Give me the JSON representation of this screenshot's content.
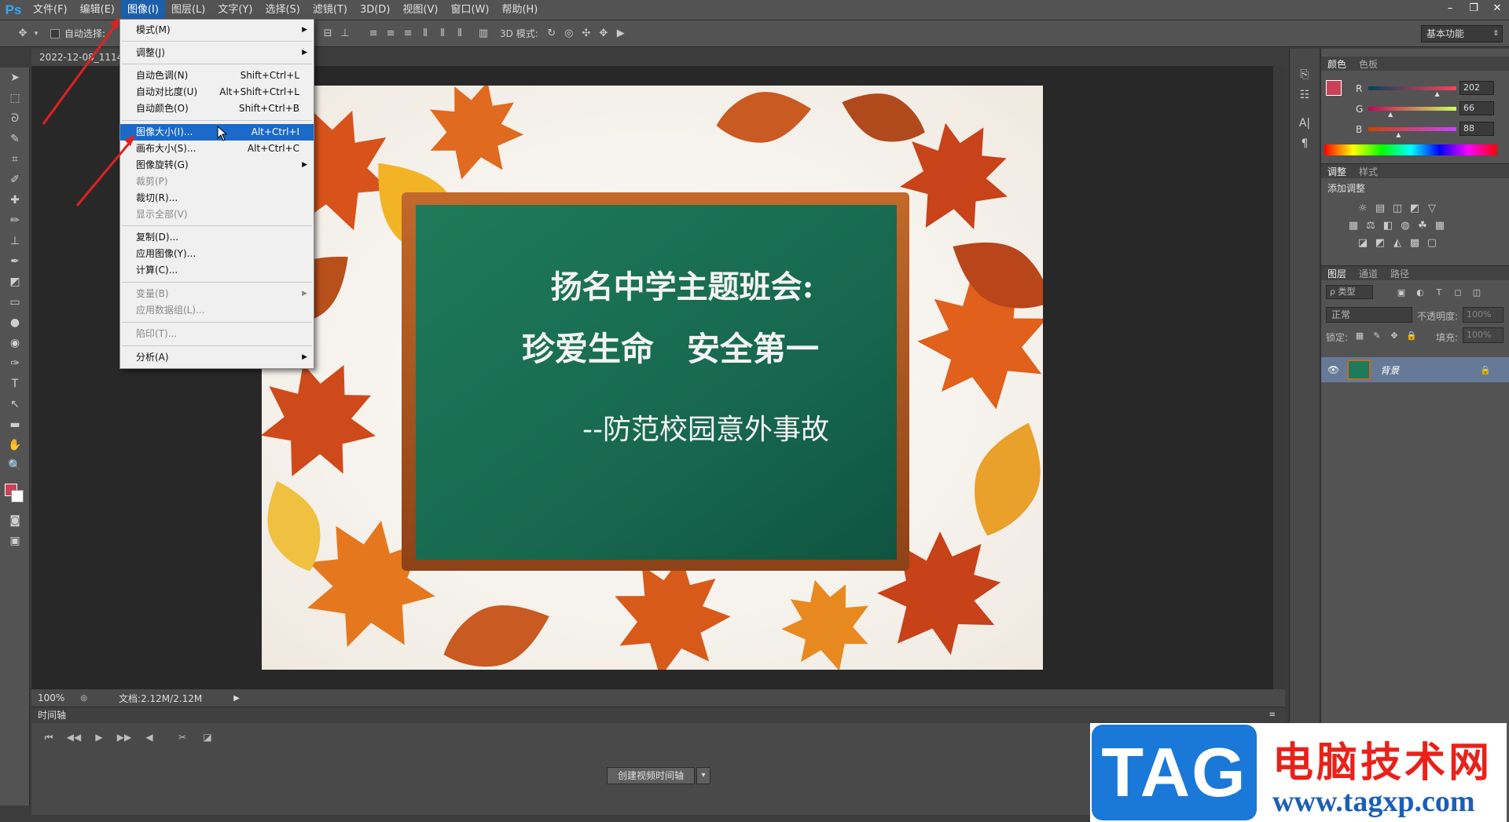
{
  "app": {
    "logo": "Ps",
    "accent": "#31a8ff"
  },
  "menubar": {
    "items": [
      "文件(F)",
      "编辑(E)",
      "图像(I)",
      "图层(L)",
      "文字(Y)",
      "选择(S)",
      "滤镜(T)",
      "3D(D)",
      "视图(V)",
      "窗口(W)",
      "帮助(H)"
    ],
    "active_index": 2
  },
  "window_controls": {
    "minimize": "–",
    "restore": "❐",
    "close": "✕"
  },
  "options": {
    "auto_select_label": "自动选择:",
    "mode_3d_label": "3D 模式:",
    "workspace": "基本功能"
  },
  "document": {
    "tab_title": "2022-12-08_1114",
    "zoom": "100%",
    "doc_info": "文档:2.12M/2.12M"
  },
  "image_content": {
    "title": "扬名中学主题班会:",
    "slogan": "珍爱生命　安全第一",
    "subtitle": "--防范校园意外事故",
    "board_color": "#17684e",
    "frame_color": "#a8541e"
  },
  "image_menu": {
    "items": [
      {
        "label": "模式(M)",
        "shortcut": "",
        "submenu": true,
        "disabled": false
      },
      {
        "label": "调整(J)",
        "shortcut": "",
        "submenu": true,
        "disabled": false
      },
      {
        "label": "自动色调(N)",
        "shortcut": "Shift+Ctrl+L",
        "submenu": false,
        "disabled": false
      },
      {
        "label": "自动对比度(U)",
        "shortcut": "Alt+Shift+Ctrl+L",
        "submenu": false,
        "disabled": false
      },
      {
        "label": "自动颜色(O)",
        "shortcut": "Shift+Ctrl+B",
        "submenu": false,
        "disabled": false
      },
      {
        "label": "图像大小(I)...",
        "shortcut": "Alt+Ctrl+I",
        "submenu": false,
        "disabled": false,
        "highlighted": true
      },
      {
        "label": "画布大小(S)...",
        "shortcut": "Alt+Ctrl+C",
        "submenu": false,
        "disabled": false
      },
      {
        "label": "图像旋转(G)",
        "shortcut": "",
        "submenu": true,
        "disabled": false
      },
      {
        "label": "裁剪(P)",
        "shortcut": "",
        "submenu": false,
        "disabled": true
      },
      {
        "label": "裁切(R)...",
        "shortcut": "",
        "submenu": false,
        "disabled": false
      },
      {
        "label": "显示全部(V)",
        "shortcut": "",
        "submenu": false,
        "disabled": true
      },
      {
        "label": "复制(D)...",
        "shortcut": "",
        "submenu": false,
        "disabled": false
      },
      {
        "label": "应用图像(Y)...",
        "shortcut": "",
        "submenu": false,
        "disabled": false
      },
      {
        "label": "计算(C)...",
        "shortcut": "",
        "submenu": false,
        "disabled": false
      },
      {
        "label": "变量(B)",
        "shortcut": "",
        "submenu": true,
        "disabled": true
      },
      {
        "label": "应用数据组(L)...",
        "shortcut": "",
        "submenu": false,
        "disabled": true
      },
      {
        "label": "陷印(T)...",
        "shortcut": "",
        "submenu": false,
        "disabled": true
      },
      {
        "label": "分析(A)",
        "shortcut": "",
        "submenu": true,
        "disabled": false
      }
    ]
  },
  "timeline": {
    "title": "时间轴",
    "create_button": "创建视频时间轴"
  },
  "color_panel": {
    "tabs": [
      "颜色",
      "色板"
    ],
    "r_label": "R",
    "g_label": "G",
    "b_label": "B",
    "r": "202",
    "g": "66",
    "b": "88",
    "r_fraction": 0.79,
    "g_fraction": 0.26,
    "b_fraction": 0.35,
    "foreground": "#ca4258"
  },
  "adjustments_panel": {
    "tabs": [
      "调整",
      "样式"
    ],
    "heading": "添加调整"
  },
  "layers_panel": {
    "tabs": [
      "图层",
      "通道",
      "路径"
    ],
    "filter_label": "ρ 类型",
    "blend_mode": "正常",
    "opacity_label": "不透明度:",
    "opacity_value": "100%",
    "lock_label": "锁定:",
    "fill_label": "填充:",
    "fill_value": "100%",
    "layer_name": "背景"
  },
  "watermark": {
    "tag": "TAG",
    "site_name": "电脑技术网",
    "url": "www.tagxp.com"
  }
}
